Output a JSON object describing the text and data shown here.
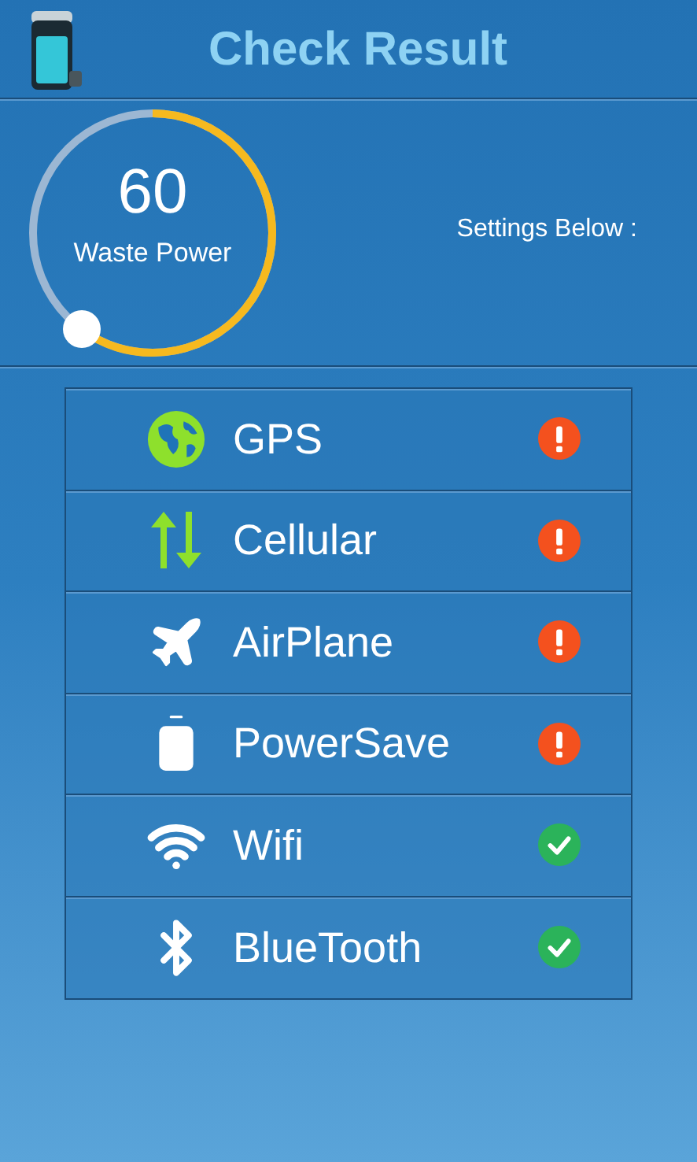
{
  "header": {
    "title": "Check Result"
  },
  "gauge": {
    "value": "60",
    "label": "Waste Power",
    "level": 0.6
  },
  "note": "Settings Below :",
  "settings": [
    {
      "kind": "globe",
      "name": "GPS",
      "ok": false
    },
    {
      "kind": "updown",
      "name": "Cellular",
      "ok": false
    },
    {
      "kind": "plane",
      "name": "AirPlane",
      "ok": false
    },
    {
      "kind": "battery",
      "name": "PowerSave",
      "ok": false
    },
    {
      "kind": "wifi",
      "name": "Wifi",
      "ok": true
    },
    {
      "kind": "bluetooth",
      "name": "BlueTooth",
      "ok": true
    }
  ]
}
